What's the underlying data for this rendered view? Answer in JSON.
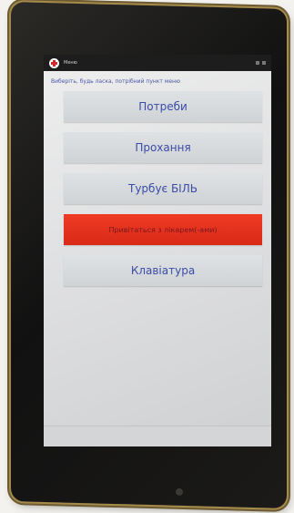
{
  "app": {
    "title": "Меню",
    "instruction": "Виберіть, будь ласка, потрібний пункт меню"
  },
  "menu": {
    "items": [
      {
        "label": "Потреби"
      },
      {
        "label": "Прохання"
      },
      {
        "label": "Турбує БІЛЬ"
      },
      {
        "label": "Привітаться з лікарем(-ами)"
      },
      {
        "label": "Клавіатура"
      }
    ],
    "highlighted_index": 3
  },
  "colors": {
    "button_bg": "#d5d9dc",
    "button_text": "#3b4ba8",
    "highlight_bg": "#e5321d",
    "status_bar": "#1d1d1d"
  },
  "icons": {
    "app_icon": "red-cross-icon"
  }
}
